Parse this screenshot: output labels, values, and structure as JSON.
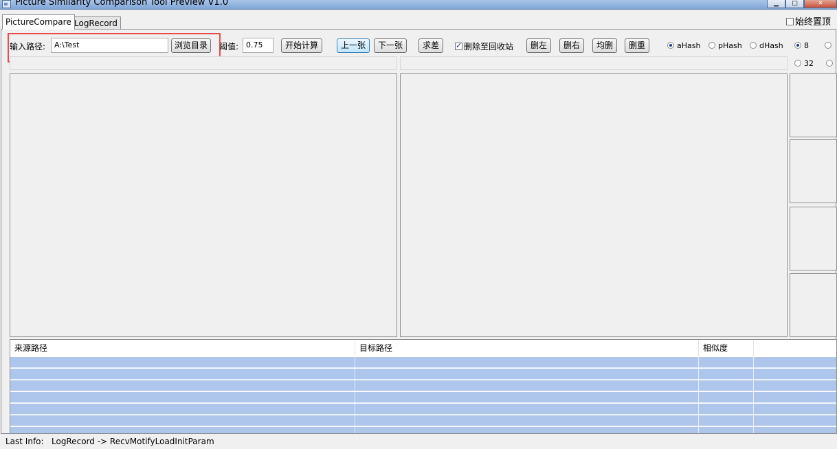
{
  "window": {
    "title": "Picture Similarity Comparison Tool Preview V1.0"
  },
  "tabs": [
    {
      "label": "PictureCompare"
    },
    {
      "label": "LogRecord"
    }
  ],
  "always_on_top": {
    "label": "始终置顶"
  },
  "toolbar": {
    "path_label": "输入路径:",
    "path_value": "A:\\Test",
    "browse_label": "浏览目录",
    "threshold_label": "阈值:",
    "threshold_value": "0.75",
    "start_label": "开始计算",
    "prev_label": "上一张",
    "next_label": "下一张",
    "diff_label": "求差",
    "recycle_label": "删除至回收站",
    "delete_left_label": "删左",
    "delete_right_label": "删右",
    "delete_both_label": "均删",
    "delete_dup_label": "删重"
  },
  "hash_options": [
    {
      "label": "aHash",
      "selected": true
    },
    {
      "label": "pHash",
      "selected": false
    },
    {
      "label": "dHash",
      "selected": false
    }
  ],
  "size_options": [
    {
      "label": "8",
      "selected": true
    },
    {
      "label": "32",
      "selected": false
    }
  ],
  "table": {
    "headers": [
      "来源路径",
      "目标路径",
      "相似度",
      ""
    ],
    "row_count": 7
  },
  "status": {
    "label": "Last Info:",
    "value": "LogRecord -> RecvMotifyLoadInitParam"
  }
}
